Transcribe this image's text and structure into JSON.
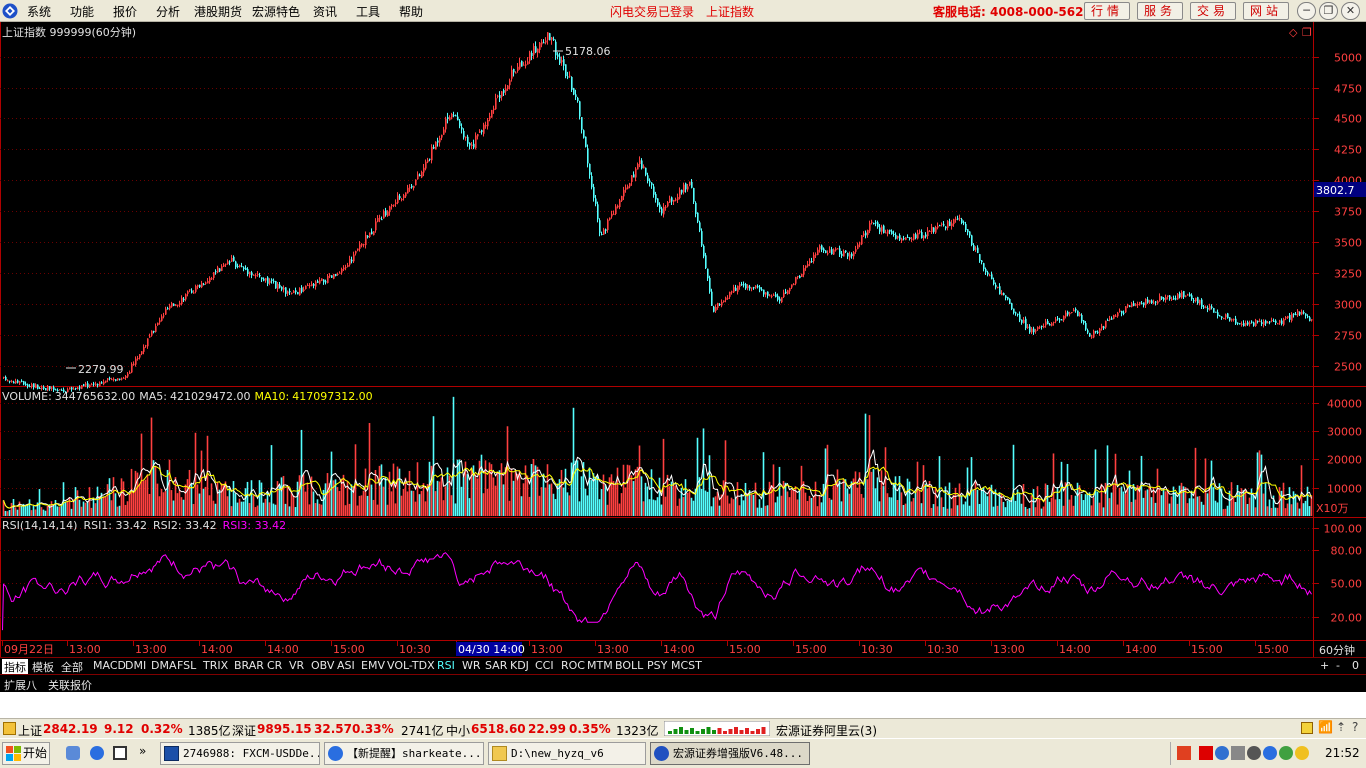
{
  "menu": {
    "items": [
      "系统",
      "功能",
      "报价",
      "分析",
      "港股期货",
      "宏源特色",
      "资讯",
      "工具",
      "帮助"
    ],
    "notice1": "闪电交易已登录",
    "notice2": "上证指数",
    "hotline": "客服电话: 4008-000-562",
    "service_buttons": [
      "行情",
      "服务",
      "交易",
      "网站"
    ]
  },
  "main_chart": {
    "title": "上证指数 999999(60分钟)",
    "high_label": "5178.06",
    "low_label": "2279.99",
    "current_price": "3802.7",
    "price_ticks": [
      "5000",
      "4750",
      "4500",
      "4250",
      "4000",
      "3750",
      "3500",
      "3250",
      "3000",
      "2750",
      "2500"
    ],
    "price_range": [
      2350,
      5230
    ]
  },
  "volume_chart": {
    "label": "VOLUME:",
    "value": "344765632.00",
    "ma5_label": "MA5:",
    "ma5_value": "421029472.00",
    "ma10_label": "MA10:",
    "ma10_value": "417097312.00",
    "ticks": [
      "40000",
      "30000",
      "20000",
      "10000"
    ],
    "unit": "X10万"
  },
  "rsi_chart": {
    "label": "RSI(14,14,14)",
    "rsi1": "RSI1: 33.42",
    "rsi2": "RSI2: 33.42",
    "rsi3": "RSI3: 33.42",
    "ticks": [
      "100.00",
      "80.00",
      "50.00",
      "20.00"
    ]
  },
  "time_axis": {
    "labels": [
      "09月22日",
      "13:00",
      "13:00",
      "14:00",
      "14:00",
      "15:00",
      "10:30",
      "04/30 14:00",
      "13:00",
      "13:00",
      "14:00",
      "15:00",
      "15:00",
      "10:30",
      "10:30",
      "13:00",
      "14:00",
      "14:00",
      "15:00",
      "15:00"
    ],
    "period": "60分钟"
  },
  "tabs": [
    "指标",
    "模板",
    "全部",
    "MACD",
    "DMI",
    "DMA",
    "FSL",
    "TRIX",
    "BRAR",
    "CR",
    "VR",
    "OBV",
    "ASI",
    "EMV",
    "VOL-TDX",
    "RSI",
    "WR",
    "SAR",
    "KDJ",
    "CCI",
    "ROC",
    "MTM",
    "BOLL",
    "PSY",
    "MCST"
  ],
  "tabs_right": [
    "+",
    "-",
    "0"
  ],
  "tabs2": [
    "扩展八",
    "关联报价"
  ],
  "status": {
    "sh_label": "上证",
    "sh_value": "2842.19",
    "sh_change": "9.12",
    "sh_pct": "0.32%",
    "sh_amount": "1385亿",
    "sz_label": "深证",
    "sz_value": "9895.15",
    "sz_change": "32.57",
    "sz_pct": "0.33%",
    "sz_amount": "2741亿",
    "zx_label": "中小",
    "zx_value": "6518.60",
    "zx_change": "22.99",
    "zx_pct": "0.35%",
    "zx_amount": "1323亿",
    "server": "宏源证券阿里云(3)"
  },
  "taskbar": {
    "start": "开始",
    "items": [
      "2746988: FXCM-USDDe...",
      "【新提醒】sharkeate...",
      "D:\\new_hyzq_v6",
      "宏源证券增强版V6.48..."
    ],
    "clock": "21:52"
  },
  "colors": {
    "up": "#ff4040",
    "down": "#54ffff",
    "ma5": "#ffffff",
    "ma10": "#ffff00",
    "rsi": "#ff00ff",
    "axis": "#b00000"
  }
}
